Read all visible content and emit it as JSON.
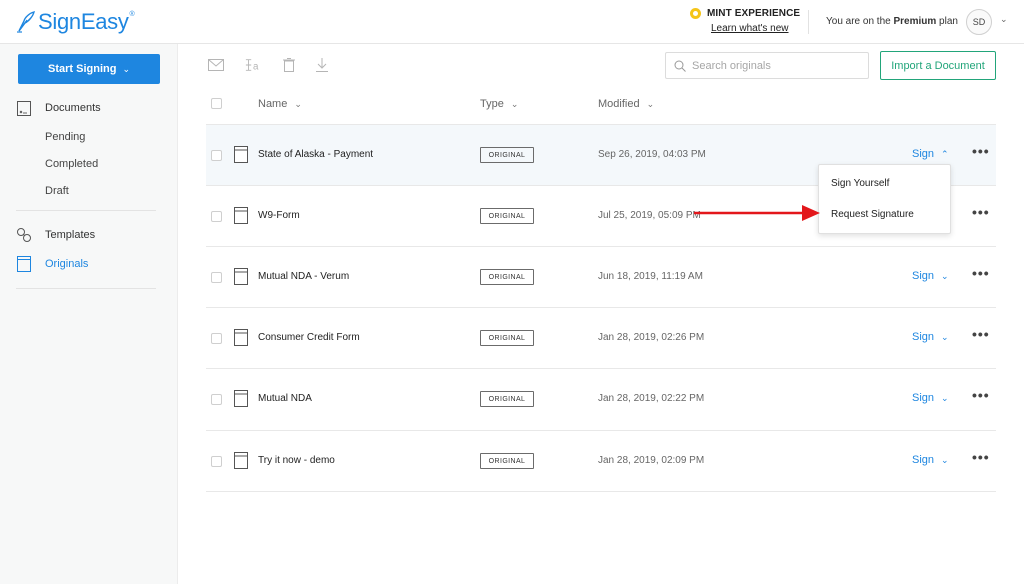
{
  "header": {
    "logo_text": "SignEasy",
    "logo_tm": "®",
    "mint_title": "MINT EXPERIENCE",
    "mint_link": "Learn what's new",
    "plan_prefix": "You are on the ",
    "plan_name": "Premium",
    "plan_suffix": " plan",
    "avatar_initials": "SD",
    "avatar_caret": "⌄"
  },
  "sidebar": {
    "start_label": "Start Signing",
    "start_chevron": "⌄",
    "documents_label": "Documents",
    "sub_items": [
      "Pending",
      "Completed",
      "Draft"
    ],
    "templates_label": "Templates",
    "originals_label": "Originals"
  },
  "search": {
    "placeholder": "Search originals"
  },
  "import_label": "Import a Document",
  "columns": {
    "name": "Name",
    "type": "Type",
    "modified": "Modified",
    "chevron": "⌄"
  },
  "rows": [
    {
      "name": "State of Alaska - Payment",
      "type": "ORIGINAL",
      "modified": "Sep 26, 2019, 04:03 PM",
      "sign": "Sign",
      "sign_chevron": "⌃",
      "more": "•••"
    },
    {
      "name": "W9-Form",
      "type": "ORIGINAL",
      "modified": "Jul 25, 2019, 05:09 PM",
      "sign": "",
      "sign_chevron": "",
      "more": "•••"
    },
    {
      "name": "Mutual NDA - Verum",
      "type": "ORIGINAL",
      "modified": "Jun 18, 2019, 11:19 AM",
      "sign": "Sign",
      "sign_chevron": "⌄",
      "more": "•••"
    },
    {
      "name": "Consumer Credit Form",
      "type": "ORIGINAL",
      "modified": "Jan 28, 2019, 02:26 PM",
      "sign": "Sign",
      "sign_chevron": "⌄",
      "more": "•••"
    },
    {
      "name": "Mutual NDA",
      "type": "ORIGINAL",
      "modified": "Jan 28, 2019, 02:22 PM",
      "sign": "Sign",
      "sign_chevron": "⌄",
      "more": "•••"
    },
    {
      "name": "Try it now - demo",
      "type": "ORIGINAL",
      "modified": "Jan 28, 2019, 02:09 PM",
      "sign": "Sign",
      "sign_chevron": "⌄",
      "more": "•••"
    }
  ],
  "dropdown": {
    "items": [
      "Sign Yourself",
      "Request Signature"
    ]
  },
  "colors": {
    "brand_blue": "#1e86e0",
    "import_green": "#22a57a",
    "annotation_red": "#e3171b",
    "mint_yellow": "#f5c518"
  }
}
